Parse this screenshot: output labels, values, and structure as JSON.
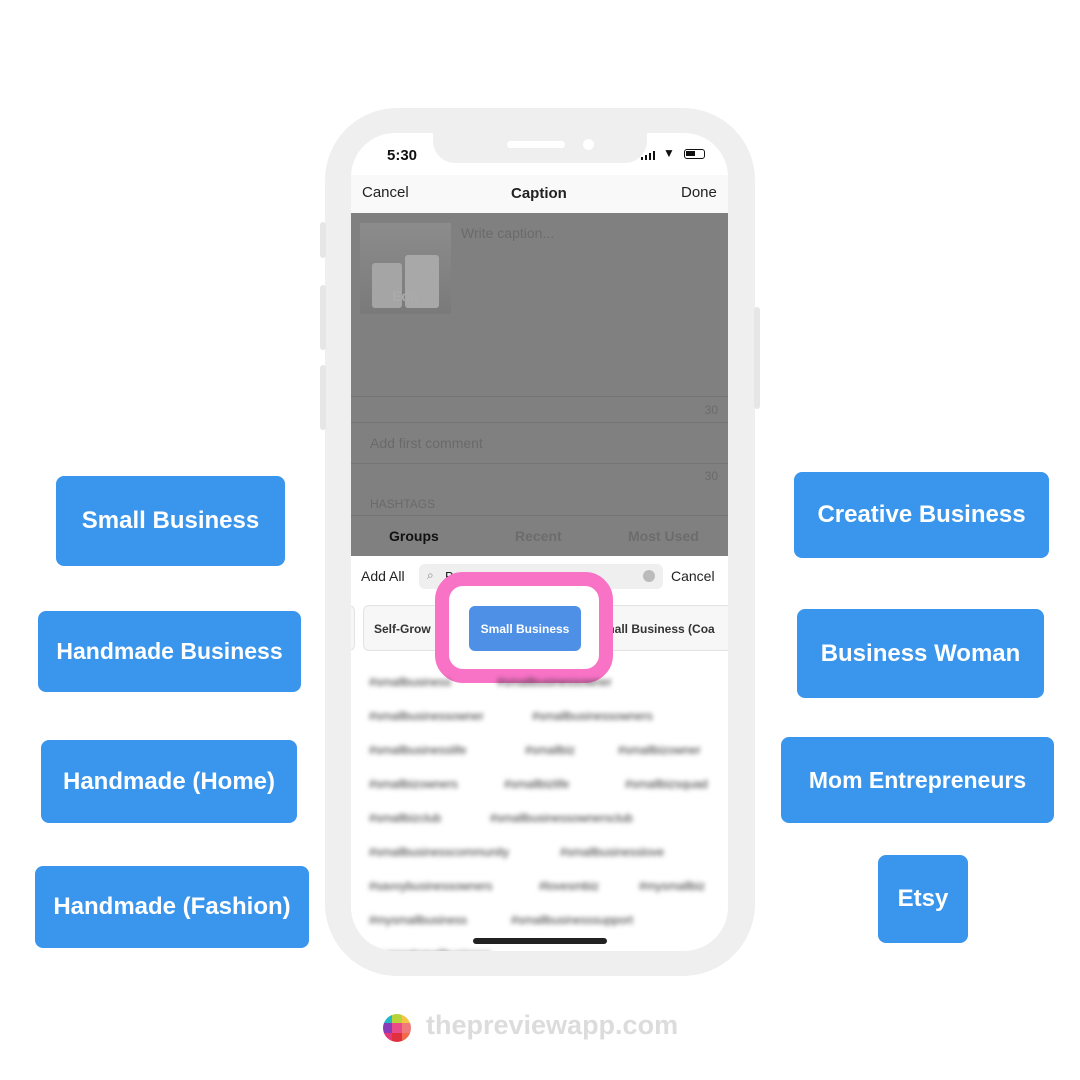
{
  "left_tags": [
    "Small Business",
    "Handmade Business",
    "Handmade (Home)",
    "Handmade (Fashion)"
  ],
  "right_tags": [
    "Creative Business",
    "Business Woman",
    "Mom Entrepreneurs",
    "Etsy"
  ],
  "status": {
    "time": "5:30"
  },
  "nav": {
    "cancel": "Cancel",
    "title": "Caption",
    "done": "Done"
  },
  "caption": {
    "placeholder": "Write caption...",
    "edit": "Edit",
    "count": "30"
  },
  "comment": {
    "placeholder": "Add first comment",
    "count": "30"
  },
  "hashtags": {
    "label": "HASHTAGS",
    "tabs": [
      "Groups",
      "Recent",
      "Most Used"
    ]
  },
  "search": {
    "add_all": "Add All",
    "value": "Bu",
    "cancel": "Cancel"
  },
  "groups": [
    "Self-Grow",
    "Small Business",
    "mall Business (Coa"
  ],
  "hashtag_rows": [
    [
      "#smallbusiness",
      "#smallbusinessowner"
    ],
    [
      "#smallbusinessowner",
      "#smallbusinessowners"
    ],
    [
      "#smallbusinesslife",
      "#smallbiz",
      "#smallbizowner"
    ],
    [
      "#smallbizowners",
      "#smallbizlife",
      "#smallbizsquad"
    ],
    [
      "#smallbizclub",
      "#smallbusinessownersclub"
    ],
    [
      "#smallbusinesscommunity",
      "#smallbusinesslove"
    ],
    [
      "#savvybusinessowners",
      "#lovesmbiz",
      "#mysmallbiz"
    ],
    [
      "#mysmallbusiness",
      "#smallbusinesssupport"
    ],
    [
      "#supportsmallbusiness"
    ]
  ],
  "footer": {
    "brand": "thepreviewapp.com"
  },
  "colors": {
    "tag": "#3a96ec",
    "highlight": "#f872c6",
    "selected_group": "#4d90e6"
  }
}
